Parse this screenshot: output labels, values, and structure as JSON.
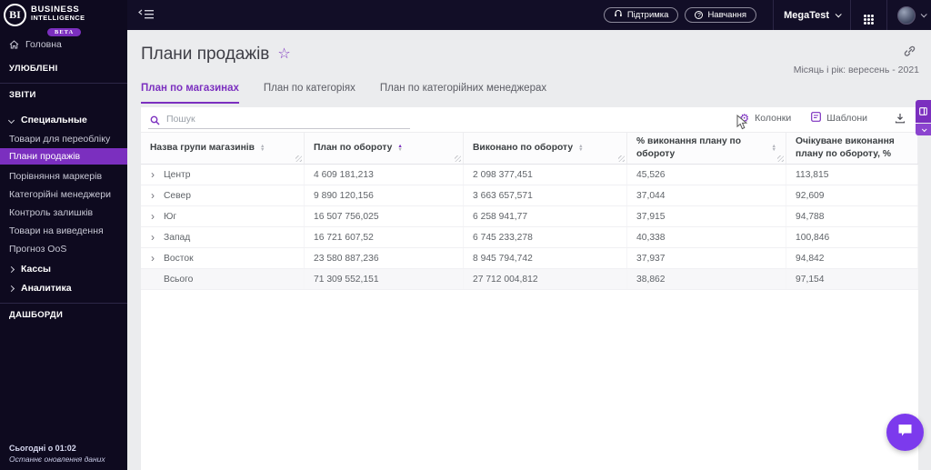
{
  "colors": {
    "accent": "#7b2fbf",
    "chat_fab": "#7c3aed",
    "topbar_bg": "#120e27",
    "sidebar_bg": "#0e0a1f"
  },
  "topbar": {
    "logo_initials": "BI",
    "logo_line1": "BUSINESS",
    "logo_line2": "INTELLIGENCE",
    "logo_badge": "BETA",
    "support_label": "Підтримка",
    "training_label": "Навчання",
    "org_label": "MegaTest"
  },
  "sidebar": {
    "home_label": "Головна",
    "favorites_header": "УЛЮБЛЕНІ",
    "reports_header": "ЗВІТИ",
    "group_special_label": "Специальные",
    "special_items": [
      "Товари для переобліку",
      "Плани продажів",
      "Порівняння маркерів",
      "Категорійні менеджери",
      "Контроль залишків",
      "Товари на виведення",
      "Прогноз OoS"
    ],
    "active_item": "Плани продажів",
    "group_kassy_label": "Кассы",
    "group_analytics_label": "Аналитика",
    "dashboards_header": "ДАШБОРДИ",
    "footer_time": "Сьогодні о 01:02",
    "footer_caption": "Останнє оновлення даних"
  },
  "page": {
    "title": "Плани продажів",
    "period_label": "Місяць і рік: вересень - 2021",
    "tabs": [
      "План по магазинах",
      "План по категоріях",
      "План по категорійних менеджерах"
    ],
    "active_tab": "План по магазинах",
    "search_placeholder": "Пошук",
    "columns_button_label": "Колонки",
    "templates_button_label": "Шаблони"
  },
  "table": {
    "columns": [
      "Назва групи магазинів",
      "План по обороту",
      "Виконано по обороту",
      "% виконання плану по обороту",
      "Очікуване виконання плану по обороту, %"
    ],
    "rows": [
      {
        "name": "Центр",
        "plan": "4 609 181,213",
        "done": "2 098 377,451",
        "pct": "45,526",
        "expected": "113,815"
      },
      {
        "name": "Север",
        "plan": "9 890 120,156",
        "done": "3 663 657,571",
        "pct": "37,044",
        "expected": "92,609"
      },
      {
        "name": "Юг",
        "plan": "16 507 756,025",
        "done": "6 258 941,77",
        "pct": "37,915",
        "expected": "94,788"
      },
      {
        "name": "Запад",
        "plan": "16 721 607,52",
        "done": "6 745 233,278",
        "pct": "40,338",
        "expected": "100,846"
      },
      {
        "name": "Восток",
        "plan": "23 580 887,236",
        "done": "8 945 794,742",
        "pct": "37,937",
        "expected": "94,842"
      },
      {
        "name": "Всього",
        "plan": "71 309 552,151",
        "done": "27 712 004,812",
        "pct": "38,862",
        "expected": "97,154"
      }
    ]
  }
}
